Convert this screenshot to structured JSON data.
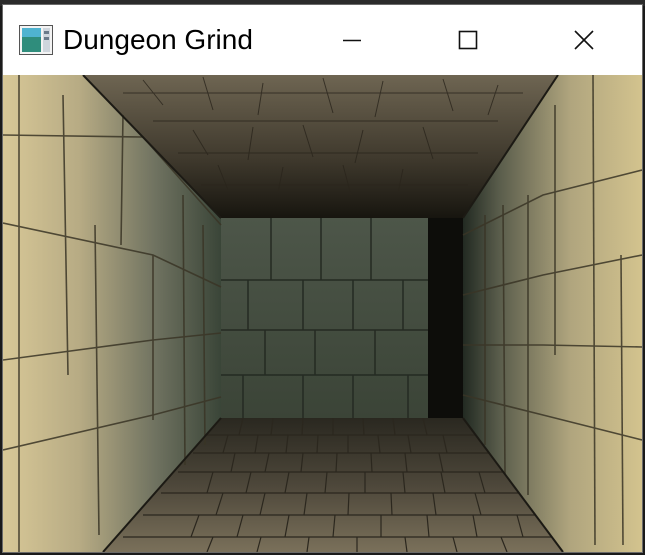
{
  "window": {
    "title": "Dungeon Grind",
    "icon": "app-window-icon",
    "controls": {
      "minimize": "minimize-icon",
      "maximize": "maximize-icon",
      "close": "close-icon"
    }
  },
  "scene": {
    "type": "first-person dungeon corridor",
    "colors": {
      "wall_light": "#c9b98a",
      "wall_dark": "#3f4a3c",
      "ceiling": "#5a5242",
      "floor": "#6b6350",
      "void": "#0b0b08"
    }
  }
}
